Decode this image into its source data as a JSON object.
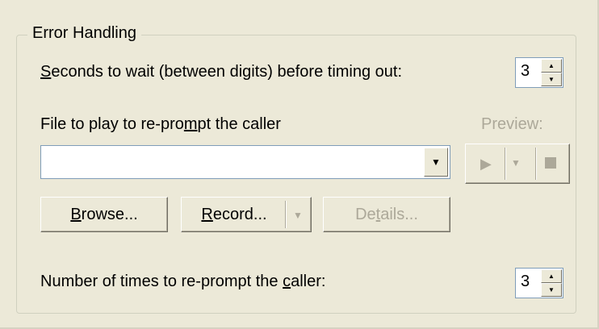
{
  "group": {
    "title": "Error Handling"
  },
  "timeout": {
    "label_prefix": "S",
    "label_rest": "econds to wait (between digits) before timing out:",
    "value": "3"
  },
  "reprompt_file": {
    "label_pre": "File to play to re-pro",
    "label_u": "m",
    "label_post": "pt the caller",
    "value": ""
  },
  "preview": {
    "label": "Preview:",
    "play_icon": "play-icon",
    "dropdown_icon": "dropdown-icon",
    "stop_icon": "stop-icon"
  },
  "buttons": {
    "browse_u": "B",
    "browse_rest": "rowse...",
    "record_u": "R",
    "record_rest": "ecord...",
    "details_pre": "De",
    "details_u": "t",
    "details_post": "ails..."
  },
  "reprompt_count": {
    "label_pre": "Number of times to re-prompt the ",
    "label_u": "c",
    "label_post": "aller:",
    "value": "3"
  }
}
